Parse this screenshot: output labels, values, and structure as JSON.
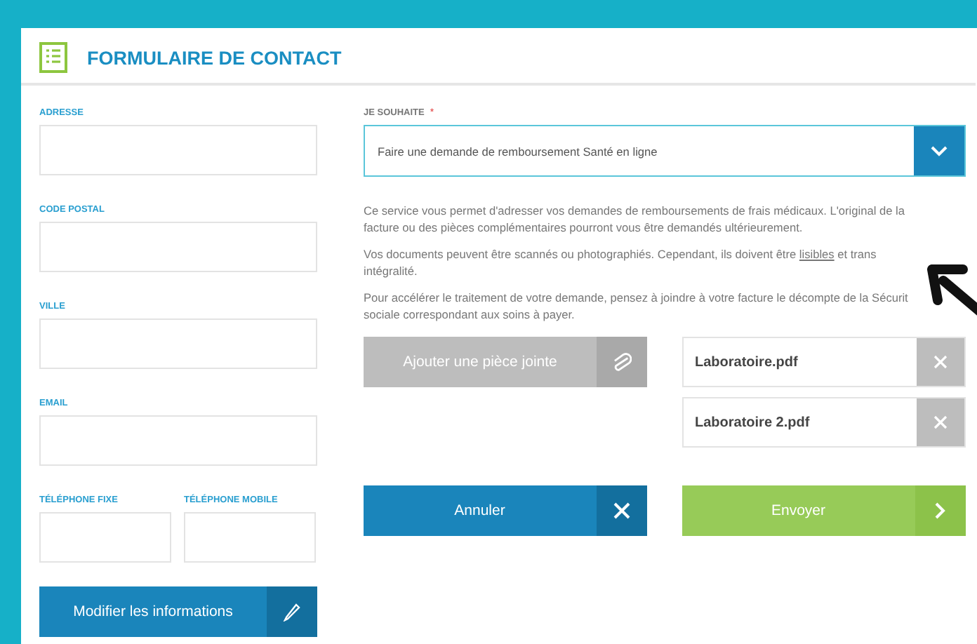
{
  "header": {
    "title": "FORMULAIRE DE CONTACT"
  },
  "contact_fields": [
    {
      "label": "ADRESSE"
    },
    {
      "label": "CODE POSTAL"
    },
    {
      "label": "VILLE"
    },
    {
      "label": "EMAIL"
    }
  ],
  "phone_fields": [
    {
      "label": "TÉLÉPHONE FIXE"
    },
    {
      "label": "TÉLÉPHONE MOBILE"
    }
  ],
  "modify_button": "Modifier les informations",
  "request": {
    "label": "JE SOUHAITE",
    "required_mark": "*",
    "value": "Faire une demande de remboursement Santé en ligne"
  },
  "paragraphs": [
    {
      "lines": [
        {
          "before": "Ce service vous permet d'adresser vos demandes de remboursements de frais médicaux. L'original de la"
        },
        {
          "before": "facture ou des pièces complémentaires pourront vous être demandés ultérieurement."
        }
      ]
    },
    {
      "lines": [
        {
          "before": "Vos documents peuvent être scannés ou photographiés. Cependant, ils doivent être ",
          "link": "lisibles",
          "after": " et trans"
        },
        {
          "before": "intégralité."
        }
      ]
    },
    {
      "lines": [
        {
          "before": "Pour accélérer le traitement de votre demande, pensez à joindre à votre facture le décompte de la Sécurit"
        },
        {
          "before": "sociale correspondant aux soins à payer."
        }
      ]
    }
  ],
  "attach_button": {
    "label": "Ajouter une pièce jointe",
    "disabled": true
  },
  "attachments": [
    {
      "name": "Laboratoire.pdf"
    },
    {
      "name": "Laboratoire 2.pdf"
    }
  ],
  "cancel_button": "Annuler",
  "send_button": "Envoyer"
}
